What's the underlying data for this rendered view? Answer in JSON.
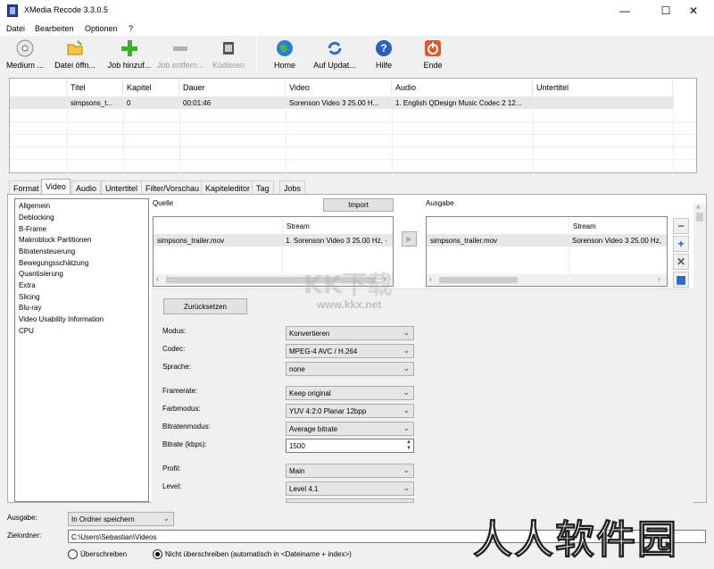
{
  "window": {
    "title": "XMedia Recode 3.3.0.5",
    "minimize": "—",
    "maximize": "☐",
    "close": "✕"
  },
  "menu": [
    "Datei",
    "Bearbeiten",
    "Optionen",
    "?"
  ],
  "toolbar": {
    "medium": "Medium ...",
    "open_file": "Datei öffn...",
    "add_job": "Job hinzuf...",
    "remove_job": "Job entfern...",
    "encode": "Kodieren",
    "home": "Home",
    "update": "Auf Updat...",
    "help": "Hilfe",
    "exit": "Ende"
  },
  "jobs": {
    "columns": [
      "Titel",
      "Kapitel",
      "Dauer",
      "Video",
      "Audio",
      "Untertitel"
    ],
    "rows": [
      {
        "title": "simpsons_t...",
        "chapter": "0",
        "duration": "00:01:46",
        "video": "Sorenson Video 3 25.00 H...",
        "audio": "1. English QDesign Music Codec 2 12...",
        "subtitle": ""
      }
    ]
  },
  "tabs": [
    "Format",
    "Video",
    "Audio",
    "Untertitel",
    "Filter/Vorschau",
    "Kapiteleditor",
    "Tag",
    "Jobs"
  ],
  "active_tab": "Video",
  "nav": [
    "Allgemein",
    "Deblocking",
    "B-Frame",
    "Makroblock Partitionen",
    "Bitratensteuerung",
    "Bewegungsschätzung",
    "Quantisierung",
    "Extra",
    "Slicing",
    "Blu-ray",
    "Video Usability Information",
    "CPU"
  ],
  "source": {
    "label": "Quelle",
    "import_button": "Import",
    "stream_header": "Stream",
    "file": "simpsons_trailer.mov",
    "stream": "1. Sorenson Video 3 25.00 Hz, ·"
  },
  "output": {
    "label": "Ausgabe",
    "stream_header": "Stream",
    "file": "simpsons_trailer.mov",
    "stream": "Sorenson Video 3 25.00 Hz,"
  },
  "settings": {
    "reset_button": "Zurücksetzen",
    "fields": [
      {
        "label": "Modus:",
        "value": "Konvertieren"
      },
      {
        "label": "Codec:",
        "value": "MPEG-4 AVC / H.264"
      },
      {
        "label": "Sprache:",
        "value": "none"
      },
      {
        "label": "Framerate:",
        "value": "Keep original"
      },
      {
        "label": "Farbmodus:",
        "value": "YUV 4:2:0 Planar 12bpp"
      },
      {
        "label": "Bitratenmodus:",
        "value": "Average bitrate"
      },
      {
        "label": "Bitrate (kbps):",
        "value": "1500"
      },
      {
        "label": "Profil:",
        "value": "Main"
      },
      {
        "label": "Level:",
        "value": "Level 4.1"
      }
    ]
  },
  "bottom": {
    "output_label": "Ausgabe:",
    "output_value": "In Ordner speichern",
    "folder_label": "Zielordner:",
    "folder_value": "C:\\Users\\Sebastian\\Videos",
    "overwrite": "Überschreiben",
    "no_overwrite": "Nicht überschreiben (automatisch in <Dateiname + index>)"
  },
  "watermarks": {
    "kk": "KK下载",
    "url": "www.kkx.net",
    "main": "人人软件园"
  }
}
